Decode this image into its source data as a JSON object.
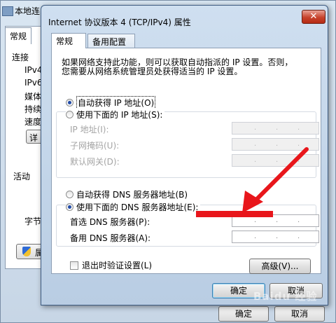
{
  "background_window": {
    "title": "本地连",
    "tab": "常规",
    "labels": [
      "连接",
      "IPv4",
      "IPv6",
      "媒体",
      "持续",
      "速度"
    ],
    "detail_button": "详",
    "activity_label": "活动",
    "bytes_label": "字节",
    "properties_button": "属",
    "ok_button": "确定",
    "cancel_button": "取消"
  },
  "dialog": {
    "title": "Internet 协议版本 4 (TCP/IPv4) 属性",
    "close_glyph": "✕",
    "tabs": [
      {
        "label": "常规",
        "active": true
      },
      {
        "label": "备用配置",
        "active": false
      }
    ],
    "description": [
      "如果网络支持此功能，则可以获取自动指派的 IP 设置。否则，",
      "您需要从网络系统管理员处获得适当的 IP 设置。"
    ],
    "ip": {
      "auto_label": "自动获得 IP 地址(O)",
      "auto_checked": true,
      "manual_label": "使用下面的 IP 地址(S):",
      "manual_checked": false,
      "fields": [
        {
          "label": "IP 地址(I):",
          "value": "",
          "disabled": true
        },
        {
          "label": "子网掩码(U):",
          "value": "",
          "disabled": true
        },
        {
          "label": "默认网关(D):",
          "value": "",
          "disabled": true
        }
      ]
    },
    "dns": {
      "auto_label": "自动获得 DNS 服务器地址(B)",
      "auto_checked": false,
      "manual_label": "使用下面的 DNS 服务器地址(E):",
      "manual_checked": true,
      "fields": [
        {
          "label": "首选 DNS 服务器(P):",
          "value": ""
        },
        {
          "label": "备用 DNS 服务器(A):",
          "value": ""
        }
      ]
    },
    "validate_label": "退出时验证设置(L)",
    "validate_checked": false,
    "advanced_button": "高级(V)...",
    "ok_button": "确定",
    "cancel_button": "取消"
  },
  "annotation": {
    "color": "#e8161b"
  },
  "watermark": "Baidu 经验",
  "colors": {
    "accent": "#1f4aa8",
    "close": "#c7432c"
  }
}
